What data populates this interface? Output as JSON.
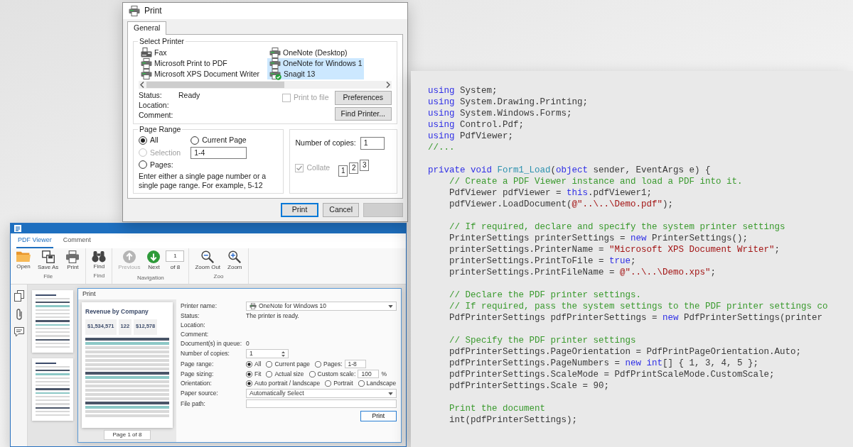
{
  "print_dialog": {
    "title": "Print",
    "tabs": [
      {
        "label": "General",
        "selected": true
      }
    ],
    "select_printer": {
      "label": "Select Printer",
      "printers": [
        {
          "name": "Fax",
          "kind": "fax",
          "selected": false,
          "default": false
        },
        {
          "name": "Microsoft Print to PDF",
          "kind": "printer",
          "selected": false,
          "default": false
        },
        {
          "name": "Microsoft XPS Document Writer",
          "kind": "printer",
          "selected": false,
          "default": false
        },
        {
          "name": "OneNote (Desktop)",
          "kind": "printer",
          "selected": false,
          "default": false
        },
        {
          "name": "OneNote for Windows 1",
          "kind": "printer",
          "selected": true,
          "default": false
        },
        {
          "name": "Snagit 13",
          "kind": "printer",
          "selected": true,
          "default": true
        }
      ],
      "status_label": "Status:",
      "status": "Ready",
      "location_label": "Location:",
      "comment_label": "Comment:",
      "print_to_file": {
        "label": "Print to file",
        "checked": false,
        "disabled": true
      },
      "buttons": [
        "Preferences",
        "Find Printer..."
      ]
    },
    "page_range": {
      "label": "Page Range",
      "options": [
        {
          "label": "All",
          "selected": true,
          "disabled": false
        },
        {
          "label": "Current Page",
          "selected": false,
          "disabled": false
        },
        {
          "label": "Selection",
          "selected": false,
          "disabled": true
        },
        {
          "label": "Pages:",
          "selected": false,
          "disabled": false
        }
      ],
      "pages_value": "1-4",
      "hint": "Enter either a single page number or a single page range.  For example, 5-12"
    },
    "copies": {
      "label": "Number of copies:",
      "value": "1",
      "collate": {
        "label": "Collate",
        "checked": true,
        "disabled": true
      },
      "collate_pages": [
        "1",
        "2",
        "3"
      ]
    },
    "buttons": [
      {
        "label": "Print",
        "default": true,
        "disabled": false
      },
      {
        "label": "Cancel",
        "default": false,
        "disabled": false
      },
      {
        "default": false,
        "disabled": true
      }
    ]
  },
  "pdf_viewer": {
    "ribbon_tabs": [
      {
        "label": "PDF Viewer",
        "selected": true
      },
      {
        "label": "Comment",
        "selected": false
      }
    ],
    "ribbon_groups": [
      {
        "label": "File",
        "items": [
          {
            "kind": "open",
            "label": "Open",
            "disabled": false
          },
          {
            "kind": "save_as",
            "label": "Save As",
            "disabled": false
          },
          {
            "kind": "print",
            "label": "Print",
            "disabled": false
          }
        ]
      },
      {
        "label": "Find",
        "items": [
          {
            "kind": "find",
            "label": "Find",
            "disabled": false
          }
        ]
      },
      {
        "label": "Navigation",
        "items": [
          {
            "kind": "previous",
            "label": "Previous",
            "disabled": true
          },
          {
            "kind": "next",
            "label": "Next",
            "disabled": false
          },
          {
            "kind": "page_field",
            "value": "1",
            "total": "of 8"
          }
        ]
      },
      {
        "label": "Zoo",
        "items": [
          {
            "kind": "zoom_out",
            "label": "Zoom Out",
            "disabled": false
          },
          {
            "kind": "zoom_in",
            "label": "Zoom",
            "disabled": false
          }
        ]
      }
    ],
    "print_window": {
      "title": "Print",
      "preview": {
        "title": "Revenue by Company",
        "kpis": [
          "$1,534,571",
          "122",
          "$12,578"
        ],
        "pager": "Page 1 of 8"
      },
      "settings": [
        {
          "kind": "printer_dropdown",
          "label": "Printer name:",
          "value": "OneNote for Windows 10"
        },
        {
          "kind": "text",
          "label": "Status:",
          "value": "The printer is ready."
        },
        {
          "kind": "text",
          "label": "Location:"
        },
        {
          "kind": "text",
          "label": "Comment:"
        },
        {
          "kind": "text",
          "label": "Document(s) in queue:",
          "value": "0"
        },
        {
          "kind": "spin",
          "label": "Number of copies:",
          "value": "1"
        },
        {
          "kind": "radios",
          "label": "Page range:",
          "options": [
            {
              "label": "All",
              "selected": true
            },
            {
              "label": "Current page",
              "selected": false
            },
            {
              "label": "Pages:",
              "selected": false,
              "field": "1-8"
            }
          ]
        },
        {
          "kind": "radios",
          "label": "Page sizing:",
          "options": [
            {
              "label": "Fit",
              "selected": true
            },
            {
              "label": "Actual size",
              "selected": false
            },
            {
              "label": "Custom scale:",
              "selected": false,
              "field": "100",
              "unit": "%"
            }
          ]
        },
        {
          "kind": "radios",
          "label": "Orientation:",
          "options": [
            {
              "label": "Auto portrait / landscape",
              "selected": true
            },
            {
              "label": "Portrait",
              "selected": false
            },
            {
              "label": "Landscape",
              "selected": false
            }
          ]
        },
        {
          "kind": "dropdown",
          "label": "Paper source:",
          "value": "Automatically Select"
        },
        {
          "kind": "field",
          "label": "File path:"
        }
      ],
      "button": "Print"
    }
  },
  "code": {
    "blocks": [
      {
        "lines": [
          {
            "tokens": [
              {
                "text": "using ",
                "kind": "keyword"
              },
              {
                "text": "System;",
                "kind": "plain"
              }
            ]
          },
          {
            "tokens": [
              {
                "text": "using ",
                "kind": "keyword"
              },
              {
                "text": "System.Drawing.Printing;",
                "kind": "plain"
              }
            ]
          },
          {
            "tokens": [
              {
                "text": "using ",
                "kind": "keyword"
              },
              {
                "text": "System.Windows.Forms;",
                "kind": "plain"
              }
            ]
          },
          {
            "tokens": [
              {
                "text": "using ",
                "kind": "keyword"
              },
              {
                "text": "Control.Pdf;",
                "kind": "plain"
              }
            ]
          },
          {
            "tokens": [
              {
                "text": "using ",
                "kind": "keyword"
              },
              {
                "text": "PdfViewer;",
                "kind": "plain"
              }
            ]
          },
          {
            "tokens": [
              {
                "text": "//...",
                "kind": "comment"
              }
            ]
          }
        ]
      },
      {
        "lines": [
          {
            "tokens": [
              {
                "text": "private void ",
                "kind": "keyword"
              },
              {
                "text": "Form1_Load",
                "kind": "type"
              },
              {
                "text": "(",
                "kind": "plain"
              },
              {
                "text": "object",
                "kind": "keyword"
              },
              {
                "text": " sender, EventArgs e) {",
                "kind": "plain"
              }
            ],
            "children": [
              {
                "lines": [
                  {
                    "tokens": [
                      {
                        "text": "// Create a PDF Viewer instance and load a PDF into it.",
                        "kind": "comment"
                      }
                    ]
                  },
                  {
                    "tokens": [
                      {
                        "text": "PdfViewer pdfViewer = ",
                        "kind": "plain"
                      },
                      {
                        "text": "this",
                        "kind": "keyword"
                      },
                      {
                        "text": ".pdfViewer1;",
                        "kind": "plain"
                      }
                    ]
                  },
                  {
                    "tokens": [
                      {
                        "text": "pdfViewer.LoadDocument(",
                        "kind": "plain"
                      },
                      {
                        "text": "@\"..\\..\\Demo.pdf\"",
                        "kind": "string"
                      },
                      {
                        "text": ");",
                        "kind": "plain"
                      }
                    ]
                  }
                ]
              },
              {
                "lines": [
                  {
                    "tokens": [
                      {
                        "text": "// If required, declare and specify the system printer settings",
                        "kind": "comment"
                      }
                    ]
                  },
                  {
                    "tokens": [
                      {
                        "text": "PrinterSettings printerSettings = ",
                        "kind": "plain"
                      },
                      {
                        "text": "new",
                        "kind": "keyword"
                      },
                      {
                        "text": " PrinterSettings();",
                        "kind": "plain"
                      }
                    ]
                  },
                  {
                    "tokens": [
                      {
                        "text": "printerSettings.PrinterName = ",
                        "kind": "plain"
                      },
                      {
                        "text": "\"Microsoft XPS Document Writer\"",
                        "kind": "string"
                      },
                      {
                        "text": ";",
                        "kind": "plain"
                      }
                    ]
                  },
                  {
                    "tokens": [
                      {
                        "text": "printerSettings.PrintToFile = ",
                        "kind": "plain"
                      },
                      {
                        "text": "true",
                        "kind": "keyword"
                      },
                      {
                        "text": ";",
                        "kind": "plain"
                      }
                    ]
                  },
                  {
                    "tokens": [
                      {
                        "text": "printerSettings.PrintFileName = ",
                        "kind": "plain"
                      },
                      {
                        "text": "@\"..\\..\\Demo.xps\"",
                        "kind": "string"
                      },
                      {
                        "text": ";",
                        "kind": "plain"
                      }
                    ]
                  }
                ]
              },
              {
                "lines": [
                  {
                    "tokens": [
                      {
                        "text": "// Declare the PDF printer settings.",
                        "kind": "comment"
                      }
                    ]
                  },
                  {
                    "tokens": [
                      {
                        "text": "// If required, pass the system settings to the PDF printer settings co",
                        "kind": "comment"
                      }
                    ]
                  },
                  {
                    "tokens": [
                      {
                        "text": "PdfPrinterSettings pdfPrinterSettings = ",
                        "kind": "plain"
                      },
                      {
                        "text": "new",
                        "kind": "keyword"
                      },
                      {
                        "text": " PdfPrinterSettings(printer",
                        "kind": "plain"
                      }
                    ]
                  }
                ]
              },
              {
                "lines": [
                  {
                    "tokens": [
                      {
                        "text": "// Specify the PDF printer settings",
                        "kind": "comment"
                      }
                    ]
                  },
                  {
                    "tokens": [
                      {
                        "text": "pdfPrinterSettings.PageOrientation = PdfPrintPageOrientation.Auto;",
                        "kind": "plain"
                      }
                    ]
                  },
                  {
                    "tokens": [
                      {
                        "text": "pdfPrinterSettings.PageNumbers = ",
                        "kind": "plain"
                      },
                      {
                        "text": "new int",
                        "kind": "keyword"
                      },
                      {
                        "text": "[] { 1, 3, 4, 5 };",
                        "kind": "plain"
                      }
                    ]
                  },
                  {
                    "tokens": [
                      {
                        "text": "pdfPrinterSettings.ScaleMode = PdfPrintScaleMode.CustomScale;",
                        "kind": "plain"
                      }
                    ]
                  },
                  {
                    "tokens": [
                      {
                        "text": "pdfPrinterSettings.Scale = 90;",
                        "kind": "plain"
                      }
                    ]
                  }
                ]
              },
              {
                "lines": [
                  {
                    "tokens": [
                      {
                        "text": "Print the document",
                        "kind": "comment"
                      }
                    ]
                  },
                  {
                    "tokens": [
                      {
                        "text": "int(pdfPrinterSettings);",
                        "kind": "plain"
                      }
                    ]
                  }
                ]
              }
            ]
          }
        ]
      }
    ]
  }
}
